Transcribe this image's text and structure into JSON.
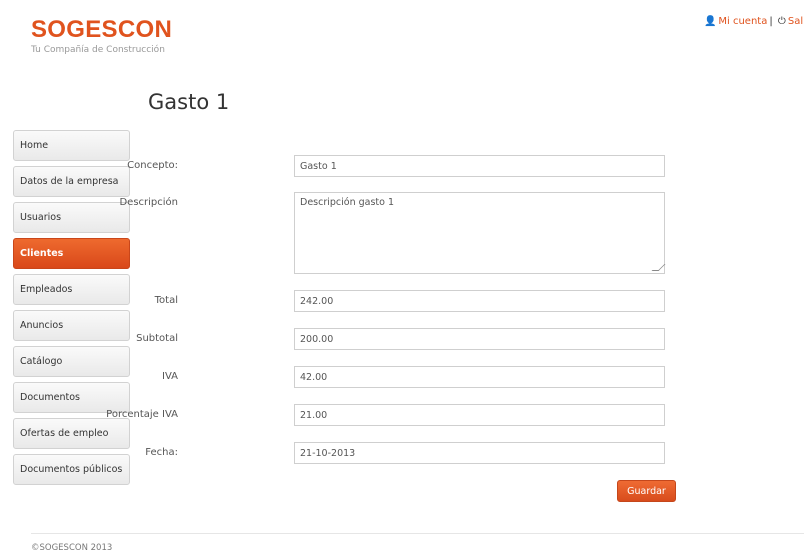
{
  "brand": {
    "name": "SOGESCON",
    "tagline": "Tu Compañía de Construcción"
  },
  "topnav": {
    "account": "Mi cuenta",
    "separator": "|",
    "logout": "Salir"
  },
  "page": {
    "title": "Gasto 1"
  },
  "sidebar": {
    "items": [
      {
        "label": "Home",
        "active": false
      },
      {
        "label": "Datos de la empresa",
        "active": false
      },
      {
        "label": "Usuarios",
        "active": false
      },
      {
        "label": "Clientes",
        "active": true
      },
      {
        "label": "Empleados",
        "active": false
      },
      {
        "label": "Anuncios",
        "active": false
      },
      {
        "label": "Catálogo",
        "active": false
      },
      {
        "label": "Documentos",
        "active": false
      },
      {
        "label": "Ofertas de empleo",
        "active": false
      },
      {
        "label": "Documentos públicos",
        "active": false
      }
    ]
  },
  "form": {
    "concepto": {
      "label": "Concepto:",
      "value": "Gasto 1"
    },
    "descripcion": {
      "label": "Descripción",
      "value": "Descripción gasto 1"
    },
    "total": {
      "label": "Total",
      "value": "242.00"
    },
    "subtotal": {
      "label": "Subtotal",
      "value": "200.00"
    },
    "iva": {
      "label": "IVA",
      "value": "42.00"
    },
    "porcentaje_iva": {
      "label": "Porcentaje IVA",
      "value": "21.00"
    },
    "fecha": {
      "label": "Fecha:",
      "value": "21-10-2013"
    },
    "save_label": "Guardar"
  },
  "footer": {
    "text": "©SOGESCON 2013"
  },
  "colors": {
    "accent": "#e0531e"
  }
}
